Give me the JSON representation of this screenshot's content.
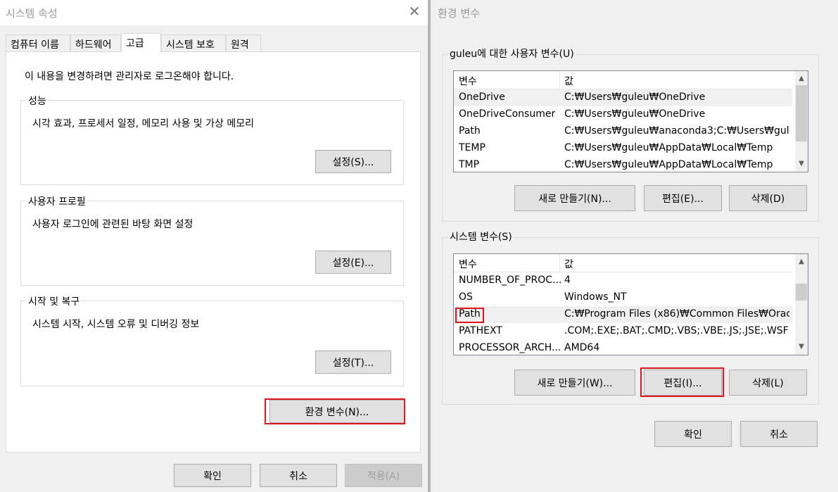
{
  "system_properties": {
    "title": "시스템 속성",
    "close_glyph": "✕",
    "tabs": [
      "컴퓨터 이름",
      "하드웨어",
      "고급",
      "시스템 보호",
      "원격"
    ],
    "active_tab": "고급",
    "admin_note": "이 내용을 변경하려면 관리자로 로그온해야 합니다.",
    "groups": [
      {
        "legend": "성능",
        "description": "시각 효과, 프로세서 일정, 메모리 사용 및 가상 메모리",
        "button": "설정(S)..."
      },
      {
        "legend": "사용자 프로필",
        "description": "사용자 로그인에 관련된 바탕 화면 설정",
        "button": "설정(E)..."
      },
      {
        "legend": "시작 및 복구",
        "description": "시스템 시작, 시스템 오류 및 디버깅 정보",
        "button": "설정(T)..."
      }
    ],
    "env_button": "환경 변수(N)...",
    "ok": "확인",
    "cancel": "취소",
    "apply": "적용(A)"
  },
  "environment_variables": {
    "title": "환경 변수",
    "user_group": {
      "legend": "guleu에 대한 사용자 변수(U)",
      "headers": [
        "변수",
        "값"
      ],
      "rows": [
        {
          "name": "OneDrive",
          "value": "C:₩Users₩guleu₩OneDrive"
        },
        {
          "name": "OneDriveConsumer",
          "value": "C:₩Users₩guleu₩OneDrive"
        },
        {
          "name": "Path",
          "value": "C:₩Users₩guleu₩anaconda3;C:₩Users₩gule..."
        },
        {
          "name": "TEMP",
          "value": "C:₩Users₩guleu₩AppData₩Local₩Temp"
        },
        {
          "name": "TMP",
          "value": "C:₩Users₩guleu₩AppData₩Local₩Temp"
        }
      ],
      "buttons": {
        "new": "새로 만들기(N)...",
        "edit": "편집(E)...",
        "delete": "삭제(D)"
      }
    },
    "system_group": {
      "legend": "시스템 변수(S)",
      "headers": [
        "변수",
        "값"
      ],
      "rows": [
        {
          "name": "NUMBER_OF_PROC...",
          "value": "4"
        },
        {
          "name": "OS",
          "value": "Windows_NT"
        },
        {
          "name": "Path",
          "value": "C:₩Program Files (x86)₩Common Files₩Orac..."
        },
        {
          "name": "PATHEXT",
          "value": ".COM;.EXE;.BAT;.CMD;.VBS;.VBE;.JS;.JSE;.WSF;..."
        },
        {
          "name": "PROCESSOR_ARCH...",
          "value": "AMD64"
        }
      ],
      "buttons": {
        "new": "새로 만들기(W)...",
        "edit": "편집(I)...",
        "delete": "삭제(L)"
      }
    },
    "ok": "확인",
    "cancel": "취소",
    "scroll_up": "▲",
    "scroll_down": "▼"
  },
  "highlight_color": "#e0141e"
}
